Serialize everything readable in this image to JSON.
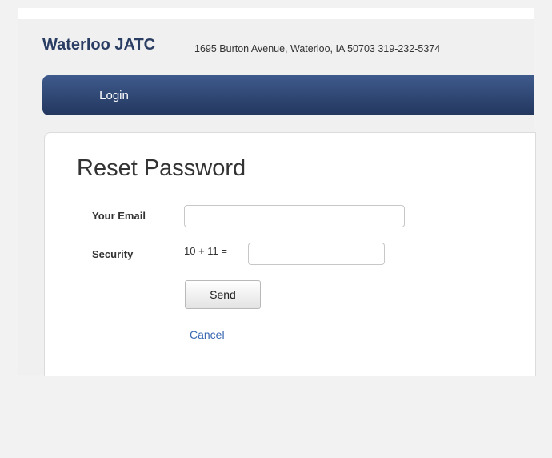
{
  "header": {
    "brand": "Waterloo JATC",
    "address": "1695 Burton Avenue, Waterloo, IA 50703   319-232-5374"
  },
  "nav": {
    "items": [
      {
        "label": "Login"
      }
    ]
  },
  "form": {
    "title": "Reset Password",
    "email_label": "Your Email",
    "email_value": "",
    "security_label": "Security",
    "security_expr": "10 + 11  =",
    "security_value": "",
    "send_label": "Send",
    "cancel_label": "Cancel"
  }
}
